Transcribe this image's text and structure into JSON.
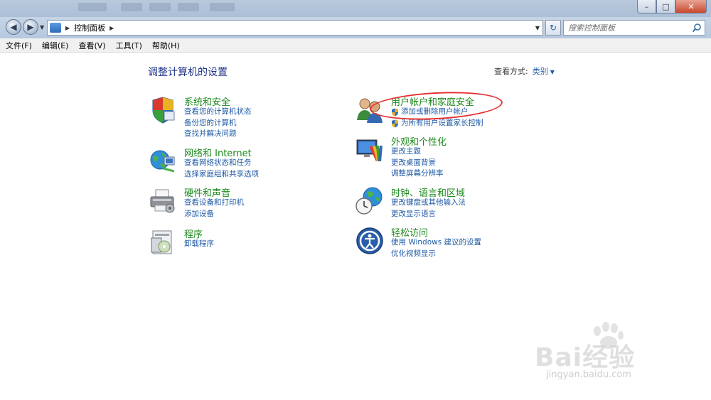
{
  "window": {
    "controls": {
      "minimize": "–",
      "maximize": "□",
      "close": "✕"
    }
  },
  "address": {
    "crumb": "控制面板",
    "search_placeholder": "搜索控制面板"
  },
  "menu": [
    "文件(F)",
    "编辑(E)",
    "查看(V)",
    "工具(T)",
    "帮助(H)"
  ],
  "main": {
    "heading": "调整计算机的设置",
    "view_by_label": "查看方式:",
    "view_by_value": "类别"
  },
  "categories": {
    "system_security": {
      "title": "系统和安全",
      "links": [
        "查看您的计算机状态",
        "备份您的计算机",
        "查找并解决问题"
      ]
    },
    "network": {
      "title": "网络和 Internet",
      "links": [
        "查看网络状态和任务",
        "选择家庭组和共享选项"
      ]
    },
    "hardware": {
      "title": "硬件和声音",
      "links": [
        "查看设备和打印机",
        "添加设备"
      ]
    },
    "programs": {
      "title": "程序",
      "links": [
        "卸载程序"
      ]
    },
    "user_accounts": {
      "title": "用户帐户和家庭安全",
      "links": [
        "添加或删除用户帐户",
        "为所有用户设置家长控制"
      ]
    },
    "appearance": {
      "title": "外观和个性化",
      "links": [
        "更改主题",
        "更改桌面背景",
        "调整屏幕分辨率"
      ]
    },
    "clock_region": {
      "title": "时钟、语言和区域",
      "links": [
        "更改键盘或其他输入法",
        "更改显示语言"
      ]
    },
    "ease_access": {
      "title": "轻松访问",
      "links": [
        "使用 Windows 建议的设置",
        "优化视频显示"
      ]
    }
  },
  "watermark": {
    "brand": "Bai经验",
    "url": "jingyan.baidu.com"
  },
  "colors": {
    "category_title": "#1d8a1d",
    "link": "#1e5aa6",
    "heading": "#1e3287",
    "annotation": "#e53030"
  }
}
